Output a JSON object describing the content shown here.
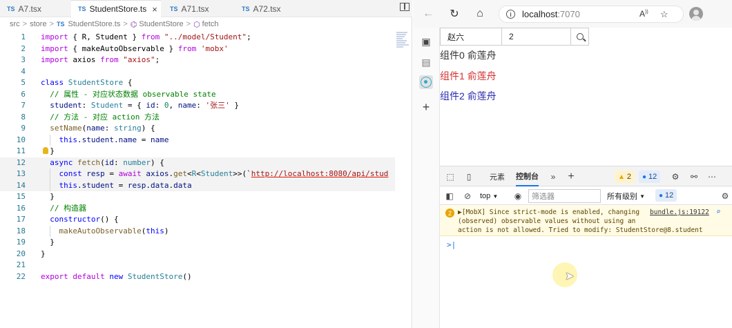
{
  "editor": {
    "tabs": [
      {
        "label": "A7.tsx",
        "lang": "TS"
      },
      {
        "label": "StudentStore.ts",
        "lang": "TS",
        "active": true,
        "close": "×"
      },
      {
        "label": "A71.tsx",
        "lang": "TS"
      },
      {
        "label": "A72.tsx",
        "lang": "TS"
      }
    ],
    "breadcrumb": {
      "parts": [
        "src",
        "store",
        "StudentStore.ts",
        "StudentStore",
        "fetch"
      ],
      "file_lang": "TS",
      "sep": ">"
    },
    "lines": [
      {
        "n": "1"
      },
      {
        "n": "2"
      },
      {
        "n": "3"
      },
      {
        "n": "4"
      },
      {
        "n": "5"
      },
      {
        "n": "6"
      },
      {
        "n": "7"
      },
      {
        "n": "8"
      },
      {
        "n": "9"
      },
      {
        "n": "10"
      },
      {
        "n": "11"
      },
      {
        "n": "12"
      },
      {
        "n": "13"
      },
      {
        "n": "14"
      },
      {
        "n": "15"
      },
      {
        "n": "16"
      },
      {
        "n": "17"
      },
      {
        "n": "18"
      },
      {
        "n": "19"
      },
      {
        "n": "20"
      },
      {
        "n": "21"
      },
      {
        "n": "22"
      }
    ],
    "code_text": {
      "import1_a": "import",
      "import1_b": " { R, Student } ",
      "import1_c": "from",
      "import1_d": " \"../model/Student\"",
      "import2_a": "import",
      "import2_b": " { makeAutoObservable } ",
      "import2_c": "from",
      "import2_d": " 'mobx'",
      "import3_a": "import",
      "import3_b": " axios ",
      "import3_c": "from",
      "import3_d": " \"axios\"",
      "l5_a": "class",
      "l5_b": " StudentStore",
      "l5_c": " {",
      "l6": "  // 属性 - 对应状态数据 observable state",
      "l7_a": "  student",
      "l7_b": ": ",
      "l7_c": "Student",
      "l7_d": " = { ",
      "l7_e": "id",
      "l7_f": ": ",
      "l7_g": "0",
      "l7_h": ", ",
      "l7_i": "name",
      "l7_j": ": ",
      "l7_k": "'张三'",
      "l7_l": " }",
      "l8": "  // 方法 - 对应 action 方法",
      "l9_a": "  setName",
      "l9_b": "(",
      "l9_c": "name",
      "l9_d": ": ",
      "l9_e": "string",
      "l9_f": ") {",
      "l10_a": "    this",
      "l10_b": ".",
      "l10_c": "student",
      "l10_d": ".",
      "l10_e": "name",
      "l10_f": " = ",
      "l10_g": "name",
      "l11": "  }",
      "l12_a": "  async",
      "l12_b": " fetch",
      "l12_c": "(",
      "l12_d": "id",
      "l12_e": ": ",
      "l12_f": "number",
      "l12_g": ") {",
      "l13_a": "    const",
      "l13_b": " resp",
      "l13_c": " = ",
      "l13_d": "await",
      "l13_e": " axios",
      "l13_f": ".",
      "l13_g": "get",
      "l13_h": "<",
      "l13_i": "R",
      "l13_j": "<",
      "l13_k": "Student",
      "l13_l": ">>(`",
      "l13_m": "http://localhost:8080/api/stud",
      "l14_a": "    this",
      "l14_b": ".",
      "l14_c": "student",
      "l14_d": " = ",
      "l14_e": "resp",
      "l14_f": ".",
      "l14_g": "data",
      "l14_h": ".",
      "l14_i": "data",
      "l15": "  }",
      "l16": "  // 构造器",
      "l17_a": "  constructor",
      "l17_b": "() {",
      "l18_a": "    makeAutoObservable",
      "l18_b": "(",
      "l18_c": "this",
      "l18_d": ")",
      "l19": "  }",
      "l20": "}",
      "l22_a": "export",
      "l22_b": " default",
      "l22_c": " new",
      "l22_d": " StudentStore",
      "l22_e": "()"
    }
  },
  "browser": {
    "nav_icons": [
      "back-arrow-icon",
      "refresh-icon",
      "home-icon"
    ],
    "url_host": "localhost",
    "url_port": ":7070",
    "read_aloud_label": "A",
    "page": {
      "name_input_value": "赵六",
      "id_input_value": "2",
      "components": [
        {
          "label": "组件0 俞莲舟",
          "color": "#222222"
        },
        {
          "label": "组件1 俞莲舟",
          "color": "#d23030"
        },
        {
          "label": "组件2 俞莲舟",
          "color": "#2a2ab0"
        }
      ]
    },
    "devtools": {
      "tabs": [
        "元素",
        "控制台"
      ],
      "more": "»",
      "add": "+",
      "warn_count": "2",
      "info_count": "12",
      "context": "top",
      "filter_placeholder": "筛选器",
      "levels": "所有级别",
      "info_count_2": "12",
      "message": {
        "count": "2",
        "line1": "▶[MobX] Since strict-mode is enabled, changing",
        "line2": "(observed) observable values without using an",
        "line3": "action is not allowed. Tried to modify: StudentStore@8.student",
        "link": "bundle.js:19122"
      },
      "prompt": ">|"
    }
  }
}
